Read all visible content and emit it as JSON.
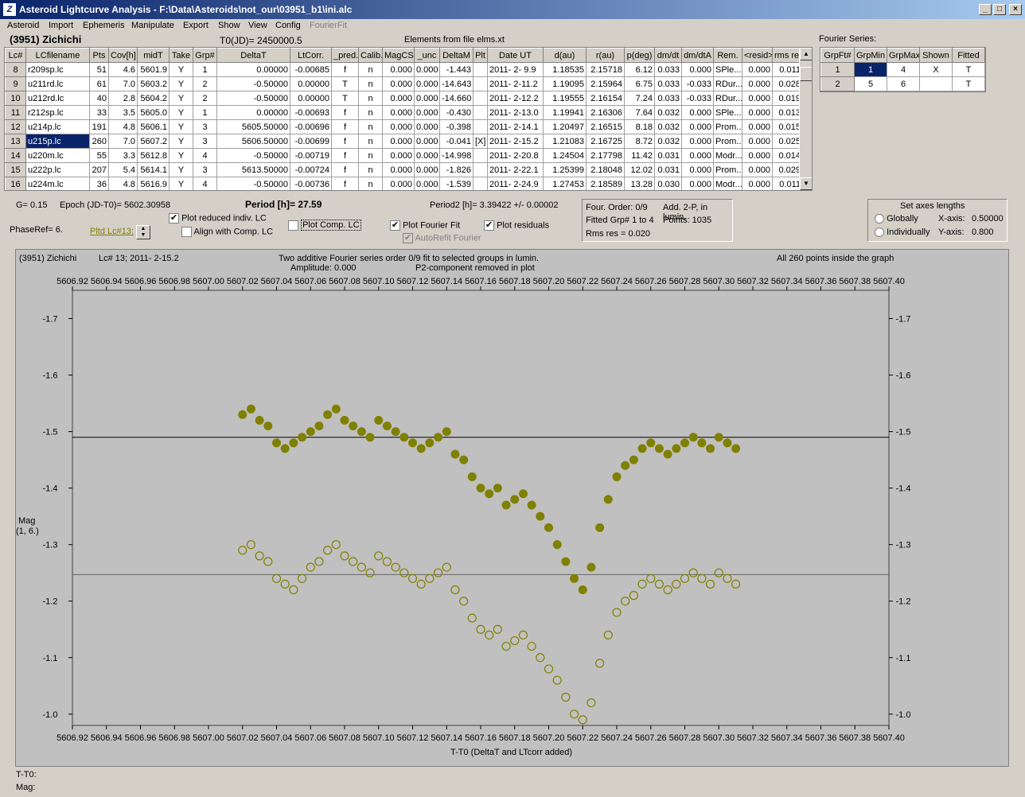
{
  "window": {
    "title": "Asteroid Lightcurve Analysis - F:\\Data\\Asteroids\\not_our\\03951_b1\\ini.alc",
    "icon": "Z"
  },
  "menu": [
    "Asteroid",
    "Import",
    "Ephemeris",
    "Manipulate",
    "Export",
    "Show",
    "View",
    "Config",
    "FourierFit"
  ],
  "header": {
    "asteroid": "(3951) Zichichi",
    "t0": "T0(JD)= 2450000.5",
    "elements": "Elements from file elms.xt"
  },
  "lc_table": {
    "columns": [
      "Lc#",
      "LCfilename",
      "Pts",
      "Cov[h]",
      "midT",
      "Take",
      "Grp#",
      "DeltaT",
      "LtCorr.",
      "_pred.",
      "Calib.",
      "MagCS",
      "_unc",
      "DeltaM",
      "Plt",
      "Date UT",
      "d(au)",
      "r(au)",
      "p(deg)",
      "dm/dt",
      "dm/dtA",
      "Rem.",
      "<resid>",
      "rms res"
    ],
    "rows": [
      [
        "8",
        "r209sp.lc",
        "51",
        "4.6",
        "5601.9",
        "Y",
        "1",
        "0.00000",
        "-0.00685",
        "f",
        "n",
        "0.000",
        "0.000",
        "-1.443",
        "",
        "2011- 2- 9.9",
        "1.18535",
        "2.15718",
        "6.12",
        "0.033",
        "0.000",
        "SPle...",
        "0.000",
        "0.011"
      ],
      [
        "9",
        "u211rd.lc",
        "61",
        "7.0",
        "5603.2",
        "Y",
        "2",
        "-0.50000",
        "0.00000",
        "T",
        "n",
        "0.000",
        "0.000",
        "-14.643",
        "",
        "2011- 2-11.2",
        "1.19095",
        "2.15964",
        "6.75",
        "0.033",
        "-0.033",
        "RDur...",
        "0.000",
        "0.028"
      ],
      [
        "10",
        "u212rd.lc",
        "40",
        "2.8",
        "5604.2",
        "Y",
        "2",
        "-0.50000",
        "0.00000",
        "T",
        "n",
        "0.000",
        "0.000",
        "-14.660",
        "",
        "2011- 2-12.2",
        "1.19555",
        "2.16154",
        "7.24",
        "0.033",
        "-0.033",
        "RDur...",
        "0.000",
        "0.019"
      ],
      [
        "11",
        "r212sp.lc",
        "33",
        "3.5",
        "5605.0",
        "Y",
        "1",
        "0.00000",
        "-0.00693",
        "f",
        "n",
        "0.000",
        "0.000",
        "-0.430",
        "",
        "2011- 2-13.0",
        "1.19941",
        "2.16306",
        "7.64",
        "0.032",
        "0.000",
        "SPle...",
        "0.000",
        "0.013"
      ],
      [
        "12",
        "u214p.lc",
        "191",
        "4.8",
        "5606.1",
        "Y",
        "3",
        "5605.50000",
        "-0.00696",
        "f",
        "n",
        "0.000",
        "0.000",
        "-0.398",
        "",
        "2011- 2-14.1",
        "1.20497",
        "2.16515",
        "8.18",
        "0.032",
        "0.000",
        "Prom...",
        "0.000",
        "0.015"
      ],
      [
        "13",
        "u215p.lc",
        "260",
        "7.0",
        "5607.2",
        "Y",
        "3",
        "5606.50000",
        "-0.00699",
        "f",
        "n",
        "0.000",
        "0.000",
        "-0.041",
        "[X]",
        "2011- 2-15.2",
        "1.21083",
        "2.16725",
        "8.72",
        "0.032",
        "0.000",
        "Prom...",
        "0.000",
        "0.025"
      ],
      [
        "14",
        "u220m.lc",
        "55",
        "3.3",
        "5612.8",
        "Y",
        "4",
        "-0.50000",
        "-0.00719",
        "f",
        "n",
        "0.000",
        "0.000",
        "-14.998",
        "",
        "2011- 2-20.8",
        "1.24504",
        "2.17798",
        "11.42",
        "0.031",
        "0.000",
        "Modr...",
        "0.000",
        "0.014"
      ],
      [
        "15",
        "u222p.lc",
        "207",
        "5.4",
        "5614.1",
        "Y",
        "3",
        "5613.50000",
        "-0.00724",
        "f",
        "n",
        "0.000",
        "0.000",
        "-1.826",
        "",
        "2011- 2-22.1",
        "1.25399",
        "2.18048",
        "12.02",
        "0.031",
        "0.000",
        "Prom...",
        "0.000",
        "0.029"
      ],
      [
        "16",
        "u224m.lc",
        "36",
        "4.8",
        "5616.9",
        "Y",
        "4",
        "-0.50000",
        "-0.00736",
        "f",
        "n",
        "0.000",
        "0.000",
        "-1.539",
        "",
        "2011- 2-24.9",
        "1.27453",
        "2.18589",
        "13.28",
        "0.030",
        "0.000",
        "Modr...",
        "0.000",
        "0.011"
      ]
    ]
  },
  "fourier": {
    "label": "Fourier Series:",
    "columns": [
      "GrpFt#",
      "GrpMin",
      "GrpMax",
      "Shown",
      "Fitted"
    ],
    "rows": [
      [
        "1",
        "1",
        "4",
        "X",
        "T"
      ],
      [
        "2",
        "5",
        "6",
        "",
        "T"
      ]
    ]
  },
  "params": {
    "g": "G= 0.15",
    "epoch": "Epoch (JD-T0)= 5602.30958",
    "period": "Period [h]= 27.59",
    "period2": "Period2 [h]= 3.39422 +/- 0.00002",
    "phaseref": "PhaseRef= 6.",
    "pltd": "Pltd Lc#13:"
  },
  "options": {
    "plot_reduced": "Plot reduced indiv. LC",
    "align": "Align with Comp. LC",
    "plot_comp": "Plot Comp. LC",
    "plot_fourier": "Plot Fourier Fit",
    "plot_resid": "Plot residuals",
    "autorefit": "AutoRefit Fourier"
  },
  "fit_info": {
    "order": "Four. Order:  0/9",
    "add": "Add. 2-P, in lumin.",
    "fitted": "Fitted Grp# 1 to 4",
    "points": "Points: 1035",
    "rms": "Rms res     = 0.020"
  },
  "axes_box": {
    "title": "Set axes lengths",
    "globally": "Globally",
    "individually": "Individually",
    "xaxis": "X-axis:",
    "xval": "0.50000",
    "yaxis": "Y-axis:",
    "yval": "0.800"
  },
  "plot": {
    "info_left": "(3951) Zichichi",
    "info_lc": "Lc# 13; 2011- 2-15.2",
    "info_center1": "Two additive Fourier series order 0/9 fit to selected groups in lumin.",
    "info_center2": "Amplitude: 0.000",
    "info_center3": "P2-component removed in plot",
    "info_right": "All 260 points inside the graph",
    "xlabel": "T-T0 (DeltaT and LTcorr added)",
    "ylabel1": "Mag",
    "ylabel2": "(1, 6.)",
    "xlim": [
      5606.92,
      5607.4
    ],
    "ylim": [
      -1.75,
      -0.98
    ],
    "xticks": [
      "5606.92",
      "5606.94",
      "5606.96",
      "5606.98",
      "5607.00",
      "5607.02",
      "5607.04",
      "5607.06",
      "5607.08",
      "5607.10",
      "5607.12",
      "5607.14",
      "5607.16",
      "5607.18",
      "5607.20",
      "5607.22",
      "5607.24",
      "5607.26",
      "5607.28",
      "5607.30",
      "5607.32",
      "5607.34",
      "5607.36",
      "5607.38",
      "5607.40"
    ],
    "yticks": [
      "-1.7",
      "-1.6",
      "-1.5",
      "-1.4",
      "-1.3",
      "-1.2",
      "-1.1",
      "-1.0"
    ],
    "fit_line_upper": -1.49,
    "fit_line_lower": -1.247,
    "point_color": "#808000"
  },
  "status": {
    "tt0": "T-T0:",
    "mag": "Mag:"
  },
  "chart_data": {
    "type": "scatter",
    "xlabel": "T-T0 (DeltaT and LTcorr added)",
    "ylabel": "Mag",
    "xlim": [
      5606.92,
      5607.4
    ],
    "ylim": [
      -1.75,
      -0.98
    ],
    "series": [
      {
        "x": [
          5607.02,
          5607.025,
          5607.03,
          5607.035,
          5607.04,
          5607.045,
          5607.05,
          5607.055,
          5607.06,
          5607.065,
          5607.07,
          5607.075,
          5607.08,
          5607.085,
          5607.09,
          5607.095,
          5607.1,
          5607.105,
          5607.11,
          5607.115,
          5607.12,
          5607.125,
          5607.13,
          5607.135,
          5607.14,
          5607.145,
          5607.15,
          5607.155,
          5607.16,
          5607.165,
          5607.17,
          5607.175,
          5607.18,
          5607.185,
          5607.19,
          5607.195,
          5607.2,
          5607.205,
          5607.21,
          5607.215,
          5607.22,
          5607.225,
          5607.23,
          5607.235,
          5607.24,
          5607.245,
          5607.25,
          5607.255,
          5607.26,
          5607.265,
          5607.27,
          5607.275,
          5607.28,
          5607.285,
          5607.29,
          5607.295,
          5607.3,
          5607.305,
          5607.31
        ],
        "y": [
          -1.53,
          -1.54,
          -1.52,
          -1.51,
          -1.48,
          -1.47,
          -1.48,
          -1.49,
          -1.5,
          -1.51,
          -1.53,
          -1.54,
          -1.52,
          -1.51,
          -1.5,
          -1.49,
          -1.52,
          -1.51,
          -1.5,
          -1.49,
          -1.48,
          -1.47,
          -1.48,
          -1.49,
          -1.5,
          -1.46,
          -1.45,
          -1.42,
          -1.4,
          -1.39,
          -1.4,
          -1.37,
          -1.38,
          -1.39,
          -1.37,
          -1.35,
          -1.33,
          -1.3,
          -1.27,
          -1.24,
          -1.22,
          -1.26,
          -1.33,
          -1.38,
          -1.42,
          -1.44,
          -1.45,
          -1.47,
          -1.48,
          -1.47,
          -1.46,
          -1.47,
          -1.48,
          -1.49,
          -1.48,
          -1.47,
          -1.49,
          -1.48,
          -1.47
        ]
      },
      {
        "x": [
          5607.02,
          5607.025,
          5607.03,
          5607.035,
          5607.04,
          5607.045,
          5607.05,
          5607.055,
          5607.06,
          5607.065,
          5607.07,
          5607.075,
          5607.08,
          5607.085,
          5607.09,
          5607.095,
          5607.1,
          5607.105,
          5607.11,
          5607.115,
          5607.12,
          5607.125,
          5607.13,
          5607.135,
          5607.14,
          5607.145,
          5607.15,
          5607.155,
          5607.16,
          5607.165,
          5607.17,
          5607.175,
          5607.18,
          5607.185,
          5607.19,
          5607.195,
          5607.2,
          5607.205,
          5607.21,
          5607.215,
          5607.22,
          5607.225,
          5607.23,
          5607.235,
          5607.24,
          5607.245,
          5607.25,
          5607.255,
          5607.26,
          5607.265,
          5607.27,
          5607.275,
          5607.28,
          5607.285,
          5607.29,
          5607.295,
          5607.3,
          5607.305,
          5607.31
        ],
        "y": [
          -1.29,
          -1.3,
          -1.28,
          -1.27,
          -1.24,
          -1.23,
          -1.22,
          -1.24,
          -1.26,
          -1.27,
          -1.29,
          -1.3,
          -1.28,
          -1.27,
          -1.26,
          -1.25,
          -1.28,
          -1.27,
          -1.26,
          -1.25,
          -1.24,
          -1.23,
          -1.24,
          -1.25,
          -1.26,
          -1.22,
          -1.2,
          -1.17,
          -1.15,
          -1.14,
          -1.15,
          -1.12,
          -1.13,
          -1.14,
          -1.12,
          -1.1,
          -1.08,
          -1.06,
          -1.03,
          -1.0,
          -0.99,
          -1.02,
          -1.09,
          -1.14,
          -1.18,
          -1.2,
          -1.21,
          -1.23,
          -1.24,
          -1.23,
          -1.22,
          -1.23,
          -1.24,
          -1.25,
          -1.24,
          -1.23,
          -1.25,
          -1.24,
          -1.23
        ]
      }
    ]
  }
}
